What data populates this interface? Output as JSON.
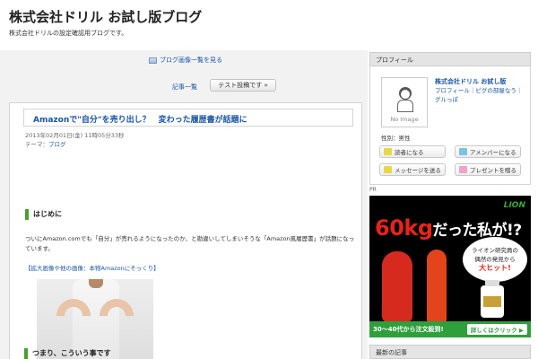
{
  "blog": {
    "title": "株式会社ドリル お試し版ブログ",
    "description": "株式会社ドリルの設定確認用ブログです。"
  },
  "main": {
    "image_list_link": "ブログ画像一覧を見る",
    "nav_list": "記事一覧",
    "nav_test_post": "テスト投稿です »"
  },
  "entry": {
    "title": "Amazonで\"自分\"を売り出し？　変わった履歴書が話題に",
    "date": "2013年02月01日(金) 11時05分33秒",
    "theme_label": "テーマ：",
    "theme_value": "ブログ",
    "section1": "はじめに",
    "body1": "ついにAmazon.comでも「自分」が売れるようになったのか、と勘違いしてしまいそうな「Amazon風履歴書」が話題になっています。",
    "image_link": "【拡大画像や他の画像：本物Amazonにそっくり】",
    "section2": "つまり、こういう事です"
  },
  "sidebar": {
    "profile_heading": "プロフィール",
    "name": "株式会社ドリル お試し版",
    "links": "プロフィール｜ピグの部屋なう｜グルっぽ",
    "noimage": "No Image",
    "sex": "性別：男性",
    "buttons": {
      "reader": "読者になる",
      "amember": "アメンバーになる",
      "message": "メッセージを送る",
      "present": "プレゼントを贈る"
    },
    "pr_label": "PR",
    "next_heading": "最新の記事"
  },
  "ad": {
    "brand": "LION",
    "headline_big": "60kg",
    "headline_rest": "だった私が!?",
    "bubble_line1": "ライオン研究員の",
    "bubble_line2": "偶然の発見から",
    "bubble_hit": "大ヒット!",
    "bar_left": "30〜40代から注文殺到!",
    "bar_cta": "詳しくはクリック ▶"
  },
  "colors": {
    "link": "#1a55a6",
    "section_accent": "#4a9e2f",
    "ad_red": "#e8231a",
    "ad_green": "#2f9f3b"
  }
}
